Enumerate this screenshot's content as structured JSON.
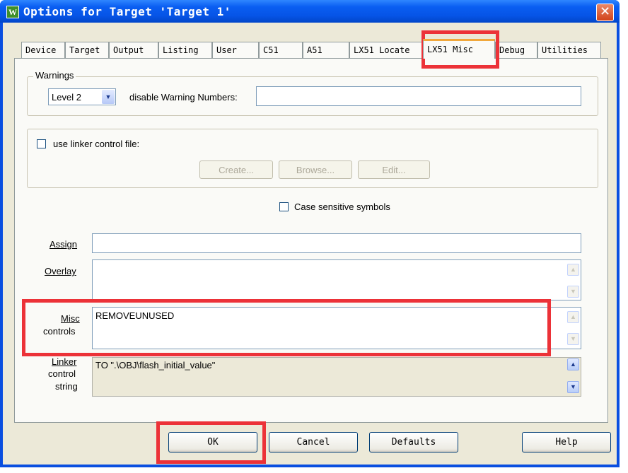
{
  "window": {
    "title": "Options for Target 'Target 1'",
    "icon_glyph": "W",
    "close_glyph": "✕"
  },
  "tabs": [
    {
      "label": "Device"
    },
    {
      "label": "Target"
    },
    {
      "label": "Output"
    },
    {
      "label": "Listing"
    },
    {
      "label": "User"
    },
    {
      "label": "C51"
    },
    {
      "label": "A51"
    },
    {
      "label": "LX51 Locate"
    },
    {
      "label": "LX51 Misc",
      "selected": true
    },
    {
      "label": "Debug"
    },
    {
      "label": "Utilities"
    }
  ],
  "warnings": {
    "legend": "Warnings",
    "level_value": "Level 2",
    "disable_label": "disable Warning Numbers:",
    "disable_value": ""
  },
  "linker_file": {
    "checkbox_label": "use linker control file:",
    "checked": false,
    "create_label": "Create...",
    "browse_label": "Browse...",
    "edit_label": "Edit..."
  },
  "case_sensitive": {
    "label": "Case sensitive symbols",
    "checked": false
  },
  "fields": {
    "assign_label": "Assign",
    "assign_value": "",
    "overlay_label": "Overlay",
    "overlay_value": "",
    "misc_label_1": "Misc",
    "misc_label_2": "controls",
    "misc_value": "REMOVEUNUSED",
    "linker_label_1": "Linker",
    "linker_label_2": "control",
    "linker_label_3": "string",
    "linker_value": "TO \".\\OBJ\\flash_initial_value\""
  },
  "buttons": {
    "ok": "OK",
    "cancel": "Cancel",
    "defaults": "Defaults",
    "help": "Help"
  },
  "icons": {
    "dropdown": "▼",
    "scroll_up": "▲",
    "scroll_down": "▼"
  },
  "colors": {
    "titlebar": "#0a5ef2",
    "highlight": "#ec3238",
    "dialog_bg": "#ece9d8"
  }
}
